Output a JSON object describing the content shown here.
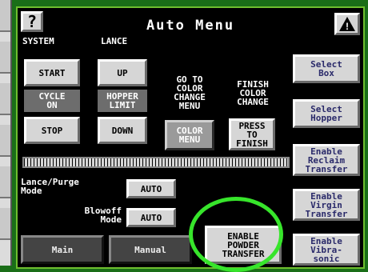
{
  "header": {
    "title": "Auto Menu",
    "help_symbol": "?",
    "warning_symbol": "!"
  },
  "groups": {
    "system": "SYSTEM",
    "lance": "LANCE"
  },
  "buttons": {
    "start": "START",
    "up": "UP",
    "stop": "STOP",
    "down": "DOWN",
    "color_menu": "COLOR\nMENU",
    "press_to_finish": "PRESS\nTO\nFINISH",
    "select_box": "Select\nBox",
    "select_hopper": "Select\nHopper",
    "enable_reclaim": "Enable\nReclaim\nTransfer",
    "enable_virgin": "Enable\nVirgin\nTransfer",
    "enable_vibrasonic": "Enable\nVibra-\nsonic",
    "main": "Main",
    "manual": "Manual",
    "enable_powder": "ENABLE\nPOWDER\nTRANSFER",
    "lance_purge_auto": "AUTO",
    "blowoff_auto": "AUTO"
  },
  "indicators": {
    "cycle_on": "CYCLE\nON",
    "hopper_limit": "HOPPER\nLIMIT"
  },
  "labels": {
    "go_to_color": "GO TO\nCOLOR\nCHANGE\nMENU",
    "finish_color": "FINISH\nCOLOR\nCHANGE",
    "lance_purge_mode": "Lance/Purge\nMode",
    "blowoff_mode": "Blowoff\nMode"
  },
  "colors": {
    "background": "#1a6e18",
    "panel": "#000000",
    "highlight_circle": "#37e52b"
  }
}
